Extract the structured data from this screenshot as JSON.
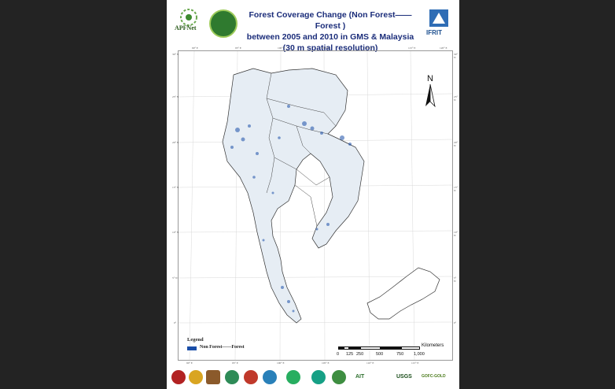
{
  "title": {
    "line1": "Forest Coverage Change (Non Forest——Forest )",
    "line2": "between 2005 and 2010 in GMS & Malaysia",
    "line3": "(30 m spatial resolution)"
  },
  "logos": {
    "apfnet": "APFNet",
    "ifrit": "IFRIT",
    "ait": "AIT",
    "usgs": "USGS",
    "gofc": "GOFC-GOLD"
  },
  "north_arrow": "N",
  "legend": {
    "title": "Legend",
    "items": [
      {
        "label": "Non Forest——Forest",
        "color": "#1a4ea8"
      }
    ]
  },
  "scale": {
    "unit": "Kilometers",
    "labels": [
      "0",
      "125",
      "250",
      "500",
      "750",
      "1,000"
    ]
  },
  "graticule": {
    "top_lon": [
      "90° E",
      "95° E",
      "100° E",
      "105° E",
      "110° E",
      "115° E",
      "120° E"
    ],
    "bottom_lon": [
      "90° E",
      "95° E",
      "100° E",
      "105° E",
      "110° E",
      "115° E"
    ],
    "lat": [
      "30° N",
      "25° N",
      "20° N",
      "15° N",
      "10° N",
      "5° N",
      "0°"
    ]
  },
  "colors": {
    "background": "#232323",
    "title": "#1b2d7a",
    "change": "#1a4ea8",
    "land": "#e6edf4"
  }
}
